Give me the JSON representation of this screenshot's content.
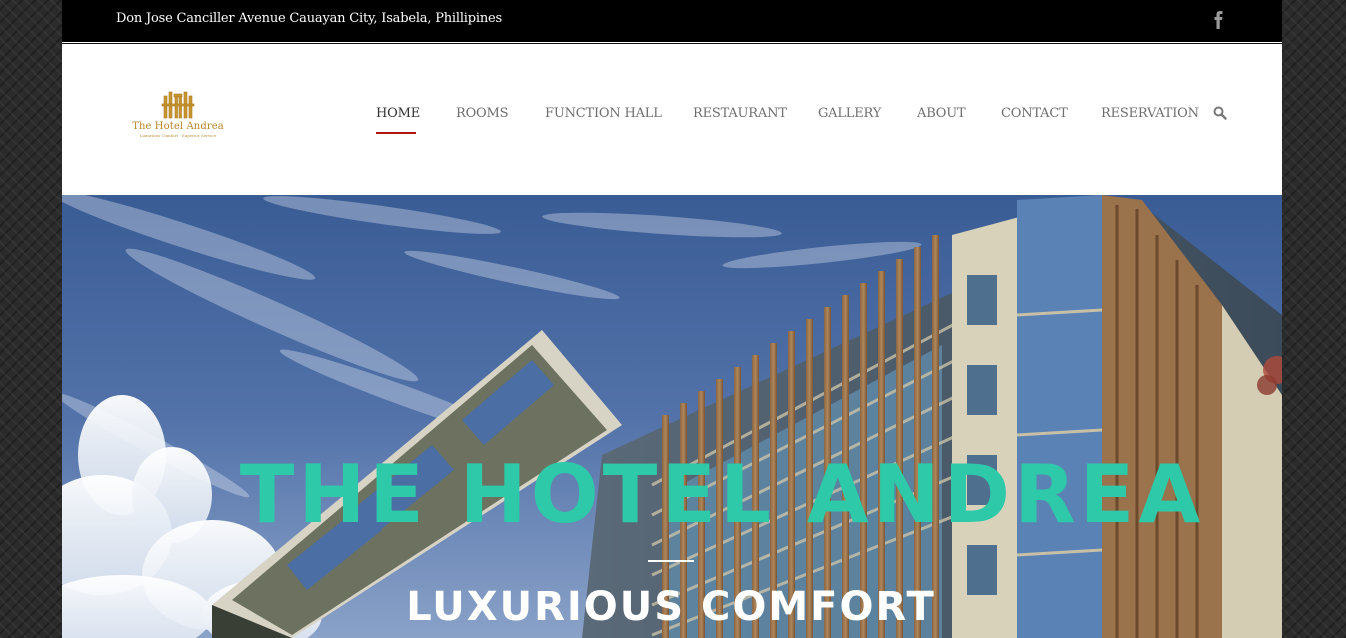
{
  "topbar": {
    "address": "Don Jose Canciller Avenue Cauayan City, Isabela, Phillipines",
    "social_icon": "facebook-icon"
  },
  "logo": {
    "name": "The Hotel Andrea",
    "tagline": "Luxurious Comfort · Superior Service",
    "color": "#b8862a"
  },
  "nav": {
    "items": [
      {
        "label": "HOME",
        "active": true
      },
      {
        "label": "ROOMS",
        "active": false
      },
      {
        "label": "FUNCTION HALL",
        "active": false
      },
      {
        "label": "RESTAURANT",
        "active": false
      },
      {
        "label": "GALLERY",
        "active": false
      },
      {
        "label": "ABOUT",
        "active": false
      },
      {
        "label": "CONTACT",
        "active": false
      },
      {
        "label": "RESERVATION",
        "active": false
      }
    ],
    "search_icon": "search-icon",
    "active_color": "#b01515"
  },
  "hero": {
    "title": "THE HOTEL ANDREA",
    "subtitle": "LUXURIOUS COMFORT",
    "title_color": "#2ec9a8"
  }
}
